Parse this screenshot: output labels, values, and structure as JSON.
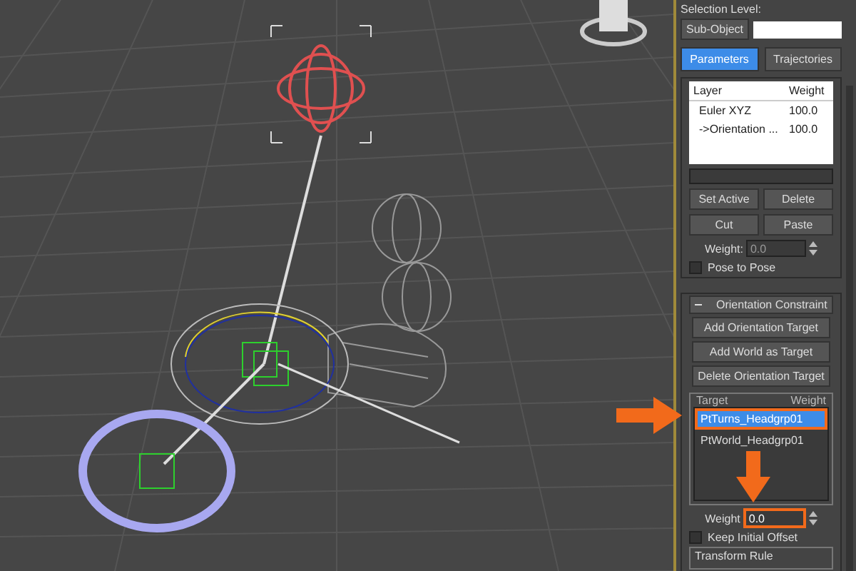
{
  "command_panel": {
    "selection_level": {
      "label": "Selection Level:",
      "sub_object_button": "Sub-Object"
    },
    "tabs": [
      {
        "label": "Parameters",
        "selected": true
      },
      {
        "label": "Trajectories",
        "selected": false
      }
    ],
    "layer_list": {
      "columns": [
        "Layer",
        "Weight"
      ],
      "rows": [
        {
          "layer": "Euler XYZ",
          "weight": "100.0"
        },
        {
          "layer": "->Orientation ...",
          "weight": "100.0"
        }
      ]
    },
    "layer_buttons": [
      "Set Active",
      "Delete",
      "Cut",
      "Paste"
    ],
    "layer_weight": {
      "label": "Weight:",
      "value": "0.0"
    },
    "pose_to_pose": {
      "label": "Pose to Pose",
      "checked": false
    }
  },
  "orientation_constraint": {
    "title": "Orientation Constraint",
    "expanded": true,
    "buttons": [
      "Add Orientation Target",
      "Add World as Target",
      "Delete Orientation Target"
    ],
    "target_list": {
      "columns": [
        "Target",
        "Weight"
      ],
      "items": [
        {
          "name": "PtTurns_Headgrp01",
          "selected": true,
          "highlighted": true
        },
        {
          "name": "PtWorld_Headgrp01",
          "selected": false,
          "highlighted": false
        }
      ]
    },
    "weight": {
      "label": "Weight",
      "value": "0.0",
      "highlighted": true
    },
    "keep_initial_offset": {
      "label": "Keep Initial Offset",
      "checked": false
    },
    "transform_rule": {
      "title": "Transform Rule"
    }
  }
}
